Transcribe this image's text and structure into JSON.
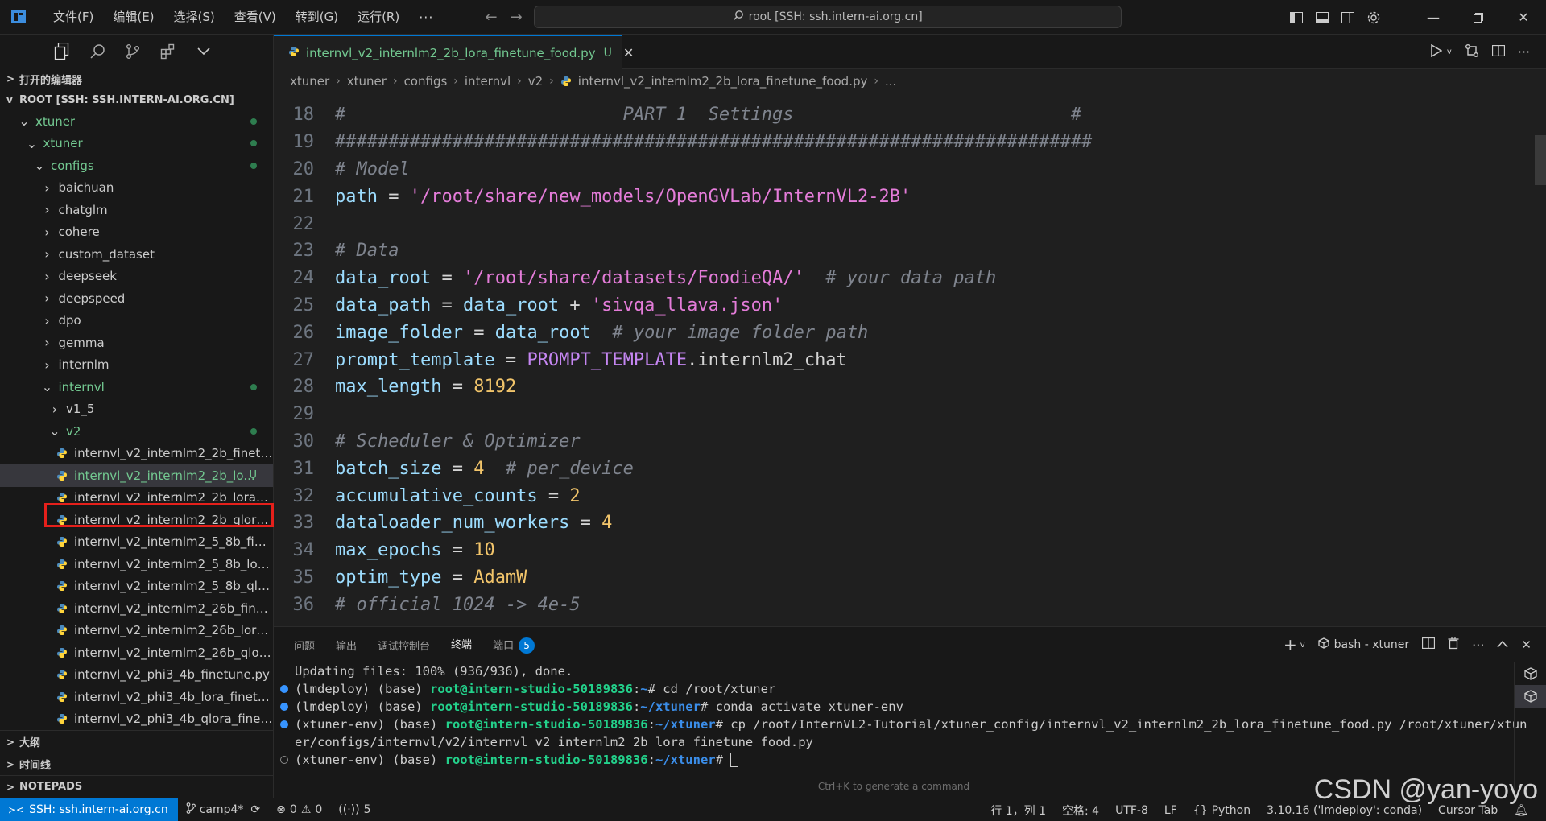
{
  "titlebar": {
    "menus": [
      "文件(F)",
      "编辑(E)",
      "选择(S)",
      "查看(V)",
      "转到(G)",
      "运行(R)"
    ],
    "more": "···",
    "search_text": "root [SSH: ssh.intern-ai.org.cn]"
  },
  "sidebar": {
    "open_editors": "打开的编辑器",
    "root": "ROOT [SSH: SSH.INTERN-AI.ORG.CN]",
    "tree": [
      {
        "label": "xtuner",
        "indent": 0,
        "chev": "v",
        "green": true,
        "dot": true
      },
      {
        "label": "xtuner",
        "indent": 1,
        "chev": "v",
        "green": true,
        "dot": true
      },
      {
        "label": "configs",
        "indent": 2,
        "chev": "v",
        "green": true,
        "dot": true
      },
      {
        "label": "baichuan",
        "indent": 3,
        "chev": ">"
      },
      {
        "label": "chatglm",
        "indent": 3,
        "chev": ">"
      },
      {
        "label": "cohere",
        "indent": 3,
        "chev": ">"
      },
      {
        "label": "custom_dataset",
        "indent": 3,
        "chev": ">"
      },
      {
        "label": "deepseek",
        "indent": 3,
        "chev": ">"
      },
      {
        "label": "deepspeed",
        "indent": 3,
        "chev": ">"
      },
      {
        "label": "dpo",
        "indent": 3,
        "chev": ">"
      },
      {
        "label": "gemma",
        "indent": 3,
        "chev": ">"
      },
      {
        "label": "internlm",
        "indent": 3,
        "chev": ">"
      },
      {
        "label": "internvl",
        "indent": 3,
        "chev": "v",
        "green": true,
        "dot": true
      },
      {
        "label": "v1_5",
        "indent": 4,
        "chev": ">"
      },
      {
        "label": "v2",
        "indent": 4,
        "chev": "v",
        "green": true,
        "dot": true
      },
      {
        "label": "internvl_v2_internlm2_2b_finetun...",
        "indent": 5,
        "file": true
      },
      {
        "label": "internvl_v2_internlm2_2b_lo...",
        "indent": 5,
        "file": true,
        "green": true,
        "selected": true,
        "badge": "U"
      },
      {
        "label": "internvl_v2_internlm2_2b_lora_fin...",
        "indent": 5,
        "file": true
      },
      {
        "label": "internvl_v2_internlm2_2b_qlora_f...",
        "indent": 5,
        "file": true
      },
      {
        "label": "internvl_v2_internlm2_5_8b_finet...",
        "indent": 5,
        "file": true
      },
      {
        "label": "internvl_v2_internlm2_5_8b_lora_...",
        "indent": 5,
        "file": true
      },
      {
        "label": "internvl_v2_internlm2_5_8b_qlora...",
        "indent": 5,
        "file": true
      },
      {
        "label": "internvl_v2_internlm2_26b_finetu...",
        "indent": 5,
        "file": true
      },
      {
        "label": "internvl_v2_internlm2_26b_lora_fi...",
        "indent": 5,
        "file": true
      },
      {
        "label": "internvl_v2_internlm2_26b_qlora_...",
        "indent": 5,
        "file": true
      },
      {
        "label": "internvl_v2_phi3_4b_finetune.py",
        "indent": 5,
        "file": true
      },
      {
        "label": "internvl_v2_phi3_4b_lora_finetun...",
        "indent": 5,
        "file": true
      },
      {
        "label": "internvl_v2_phi3_4b_qlora_finetu...",
        "indent": 5,
        "file": true
      }
    ],
    "outline": "大纲",
    "timeline": "时间线",
    "notepads": "NOTEPADS"
  },
  "editor": {
    "tab_label": "internvl_v2_internlm2_2b_lora_finetune_food.py",
    "tab_badge": "U",
    "breadcrumb": [
      "xtuner",
      "xtuner",
      "configs",
      "internvl",
      "v2",
      "internvl_v2_internlm2_2b_lora_finetune_food.py",
      "..."
    ],
    "lines": [
      {
        "n": "18",
        "tokens": [
          [
            "c-gray",
            "#                          PART 1  Settings                          #"
          ]
        ]
      },
      {
        "n": "19",
        "tokens": [
          [
            "c-gray",
            "#######################################################################"
          ]
        ]
      },
      {
        "n": "20",
        "tokens": [
          [
            "c-gray",
            "# Model"
          ]
        ]
      },
      {
        "n": "21",
        "tokens": [
          [
            "c-var",
            "path"
          ],
          [
            "c-op",
            " = "
          ],
          [
            "c-str",
            "'/root/share/new_models/OpenGVLab/InternVL2-2B'"
          ]
        ]
      },
      {
        "n": "22",
        "tokens": []
      },
      {
        "n": "23",
        "tokens": [
          [
            "c-gray",
            "# Data"
          ]
        ]
      },
      {
        "n": "24",
        "tokens": [
          [
            "c-var",
            "data_root"
          ],
          [
            "c-op",
            " = "
          ],
          [
            "c-str",
            "'/root/share/datasets/FoodieQA/'"
          ],
          [
            "c-op",
            "  "
          ],
          [
            "c-gray",
            "# your data path"
          ]
        ]
      },
      {
        "n": "25",
        "tokens": [
          [
            "c-var",
            "data_path"
          ],
          [
            "c-op",
            " = "
          ],
          [
            "c-var",
            "data_root"
          ],
          [
            "c-op",
            " + "
          ],
          [
            "c-str",
            "'sivqa_llava.json'"
          ]
        ]
      },
      {
        "n": "26",
        "tokens": [
          [
            "c-var",
            "image_folder"
          ],
          [
            "c-op",
            " = "
          ],
          [
            "c-var",
            "data_root"
          ],
          [
            "c-op",
            "  "
          ],
          [
            "c-gray",
            "# your image folder path"
          ]
        ]
      },
      {
        "n": "27",
        "tokens": [
          [
            "c-var",
            "prompt_template"
          ],
          [
            "c-op",
            " = "
          ],
          [
            "c-cls",
            "PROMPT_TEMPLATE"
          ],
          [
            "c-op",
            ".internlm2_chat"
          ]
        ]
      },
      {
        "n": "28",
        "tokens": [
          [
            "c-var",
            "max_length"
          ],
          [
            "c-op",
            " = "
          ],
          [
            "c-num",
            "8192"
          ]
        ]
      },
      {
        "n": "29",
        "tokens": []
      },
      {
        "n": "30",
        "tokens": [
          [
            "c-gray",
            "# Scheduler & Optimizer"
          ]
        ]
      },
      {
        "n": "31",
        "tokens": [
          [
            "c-var",
            "batch_size"
          ],
          [
            "c-op",
            " = "
          ],
          [
            "c-num",
            "4"
          ],
          [
            "c-op",
            "  "
          ],
          [
            "c-gray",
            "# per_device"
          ]
        ]
      },
      {
        "n": "32",
        "tokens": [
          [
            "c-var",
            "accumulative_counts"
          ],
          [
            "c-op",
            " = "
          ],
          [
            "c-num",
            "2"
          ]
        ]
      },
      {
        "n": "33",
        "tokens": [
          [
            "c-var",
            "dataloader_num_workers"
          ],
          [
            "c-op",
            " = "
          ],
          [
            "c-num",
            "4"
          ]
        ]
      },
      {
        "n": "34",
        "tokens": [
          [
            "c-var",
            "max_epochs"
          ],
          [
            "c-op",
            " = "
          ],
          [
            "c-num",
            "10"
          ]
        ]
      },
      {
        "n": "35",
        "tokens": [
          [
            "c-var",
            "optim_type"
          ],
          [
            "c-op",
            " = "
          ],
          [
            "c-yel",
            "AdamW"
          ]
        ]
      },
      {
        "n": "36",
        "tokens": [
          [
            "c-gray",
            "# official 1024 -> 4e-5"
          ]
        ]
      }
    ]
  },
  "panel": {
    "tabs": [
      "问题",
      "输出",
      "调试控制台",
      "终端",
      "端口"
    ],
    "active_tab": "终端",
    "ports_badge": "5",
    "terminal_name": "bash - xtuner",
    "terminal_lines": [
      {
        "dot": "",
        "parts": [
          [
            "",
            "Updating files: 100% (936/936), done."
          ]
        ]
      },
      {
        "dot": "blue",
        "parts": [
          [
            "",
            "(lmdeploy) (base) "
          ],
          [
            "t-green",
            "root@intern-studio-50189836"
          ],
          [
            "",
            ":"
          ],
          [
            "t-blue",
            "~"
          ],
          [
            "",
            "# cd /root/xtuner"
          ]
        ]
      },
      {
        "dot": "blue",
        "parts": [
          [
            "",
            "(lmdeploy) (base) "
          ],
          [
            "t-green",
            "root@intern-studio-50189836"
          ],
          [
            "",
            ":"
          ],
          [
            "t-blue",
            "~/xtuner"
          ],
          [
            "",
            "# conda activate xtuner-env"
          ]
        ]
      },
      {
        "dot": "blue",
        "parts": [
          [
            "",
            "(xtuner-env) (base) "
          ],
          [
            "t-green",
            "root@intern-studio-50189836"
          ],
          [
            "",
            ":"
          ],
          [
            "t-blue",
            "~/xtuner"
          ],
          [
            "",
            "# cp /root/InternVL2-Tutorial/xtuner_config/internvl_v2_internlm2_2b_lora_finetune_food.py /root/xtuner/xtun"
          ]
        ]
      },
      {
        "dot": "",
        "parts": [
          [
            "",
            "er/configs/internvl/v2/internvl_v2_internlm2_2b_lora_finetune_food.py"
          ]
        ]
      },
      {
        "dot": "hollow",
        "parts": [
          [
            "",
            "(xtuner-env) (base) "
          ],
          [
            "t-green",
            "root@intern-studio-50189836"
          ],
          [
            "",
            ":"
          ],
          [
            "t-blue",
            "~/xtuner"
          ],
          [
            "",
            "# "
          ]
        ],
        "cursor": true
      }
    ],
    "hint": "Ctrl+K to generate a command"
  },
  "statusbar": {
    "remote": "SSH: ssh.intern-ai.org.cn",
    "branch": "camp4*",
    "errors": "0",
    "warnings": "0",
    "ports": "5",
    "position": "行 1，列 1",
    "spaces": "空格: 4",
    "encoding": "UTF-8",
    "eol": "LF",
    "language": "Python",
    "interpreter": "3.10.16 ('lmdeploy': conda)",
    "cursor_tab": "Cursor Tab"
  },
  "watermark": "CSDN @yan-yoyo",
  "colors": {
    "accent": "#0078d4",
    "selection_outline": "#e5201b",
    "git_untracked": "#73c991"
  }
}
